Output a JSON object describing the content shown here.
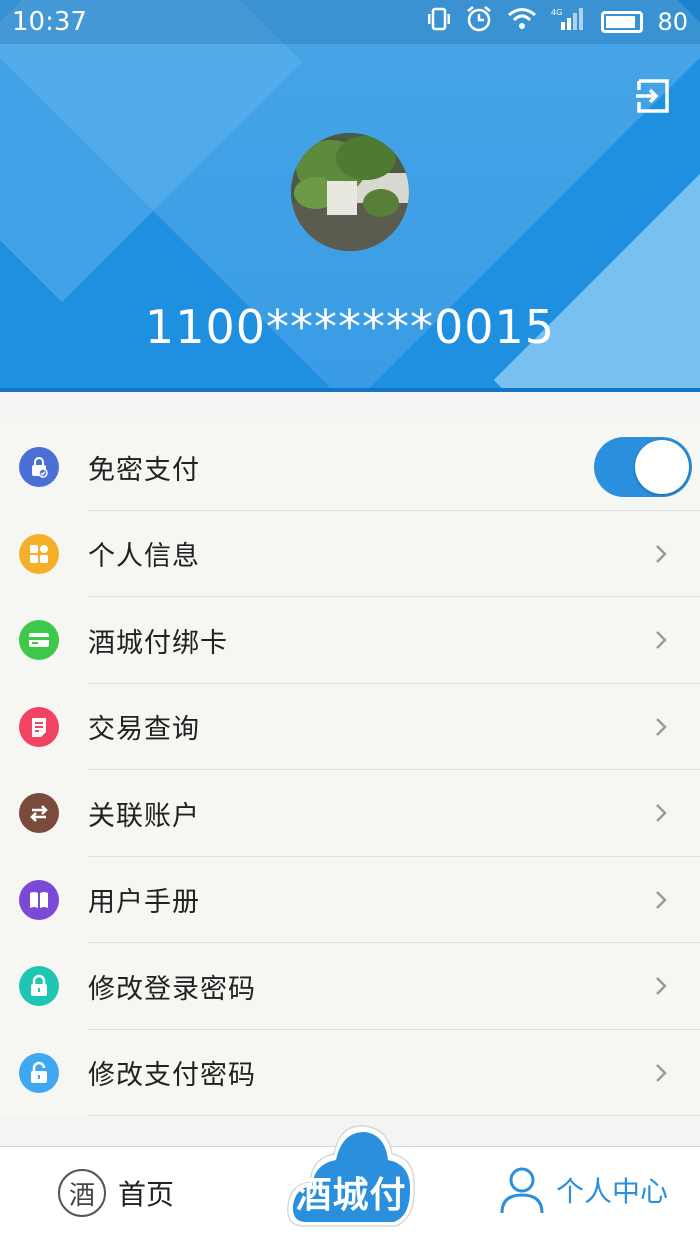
{
  "status_bar": {
    "time": "10:37",
    "battery": "80",
    "network": "4G"
  },
  "profile": {
    "account": "1100*******0015",
    "avatar_alt": "plant-photo"
  },
  "colors": {
    "primary": "#2a8fdc",
    "header_blue": "#1f8fe0",
    "icon_free_pay": "#4a6fd6",
    "icon_personal": "#f5b02b",
    "icon_bindcard": "#3ec84a",
    "icon_transaction": "#f04462",
    "icon_linked": "#7a4a3a",
    "icon_manual": "#7a4ad6",
    "icon_login_pwd": "#1fc6b4",
    "icon_pay_pwd": "#3fa8f0"
  },
  "menu": {
    "items": [
      {
        "label": "免密支付",
        "icon": "lock-check-icon",
        "control": "toggle",
        "toggle_on": true
      },
      {
        "label": "个人信息",
        "icon": "grid-icon"
      },
      {
        "label": "酒城付绑卡",
        "icon": "card-icon"
      },
      {
        "label": "交易查询",
        "icon": "receipt-icon"
      },
      {
        "label": "关联账户",
        "icon": "swap-icon"
      },
      {
        "label": "用户手册",
        "icon": "book-icon"
      },
      {
        "label": "修改登录密码",
        "icon": "lock-icon"
      },
      {
        "label": "修改支付密码",
        "icon": "unlock-icon"
      }
    ]
  },
  "tabbar": {
    "home_logo": "酒",
    "home_label": "首页",
    "center_label": "酒城付",
    "me_label": "个人中心"
  }
}
